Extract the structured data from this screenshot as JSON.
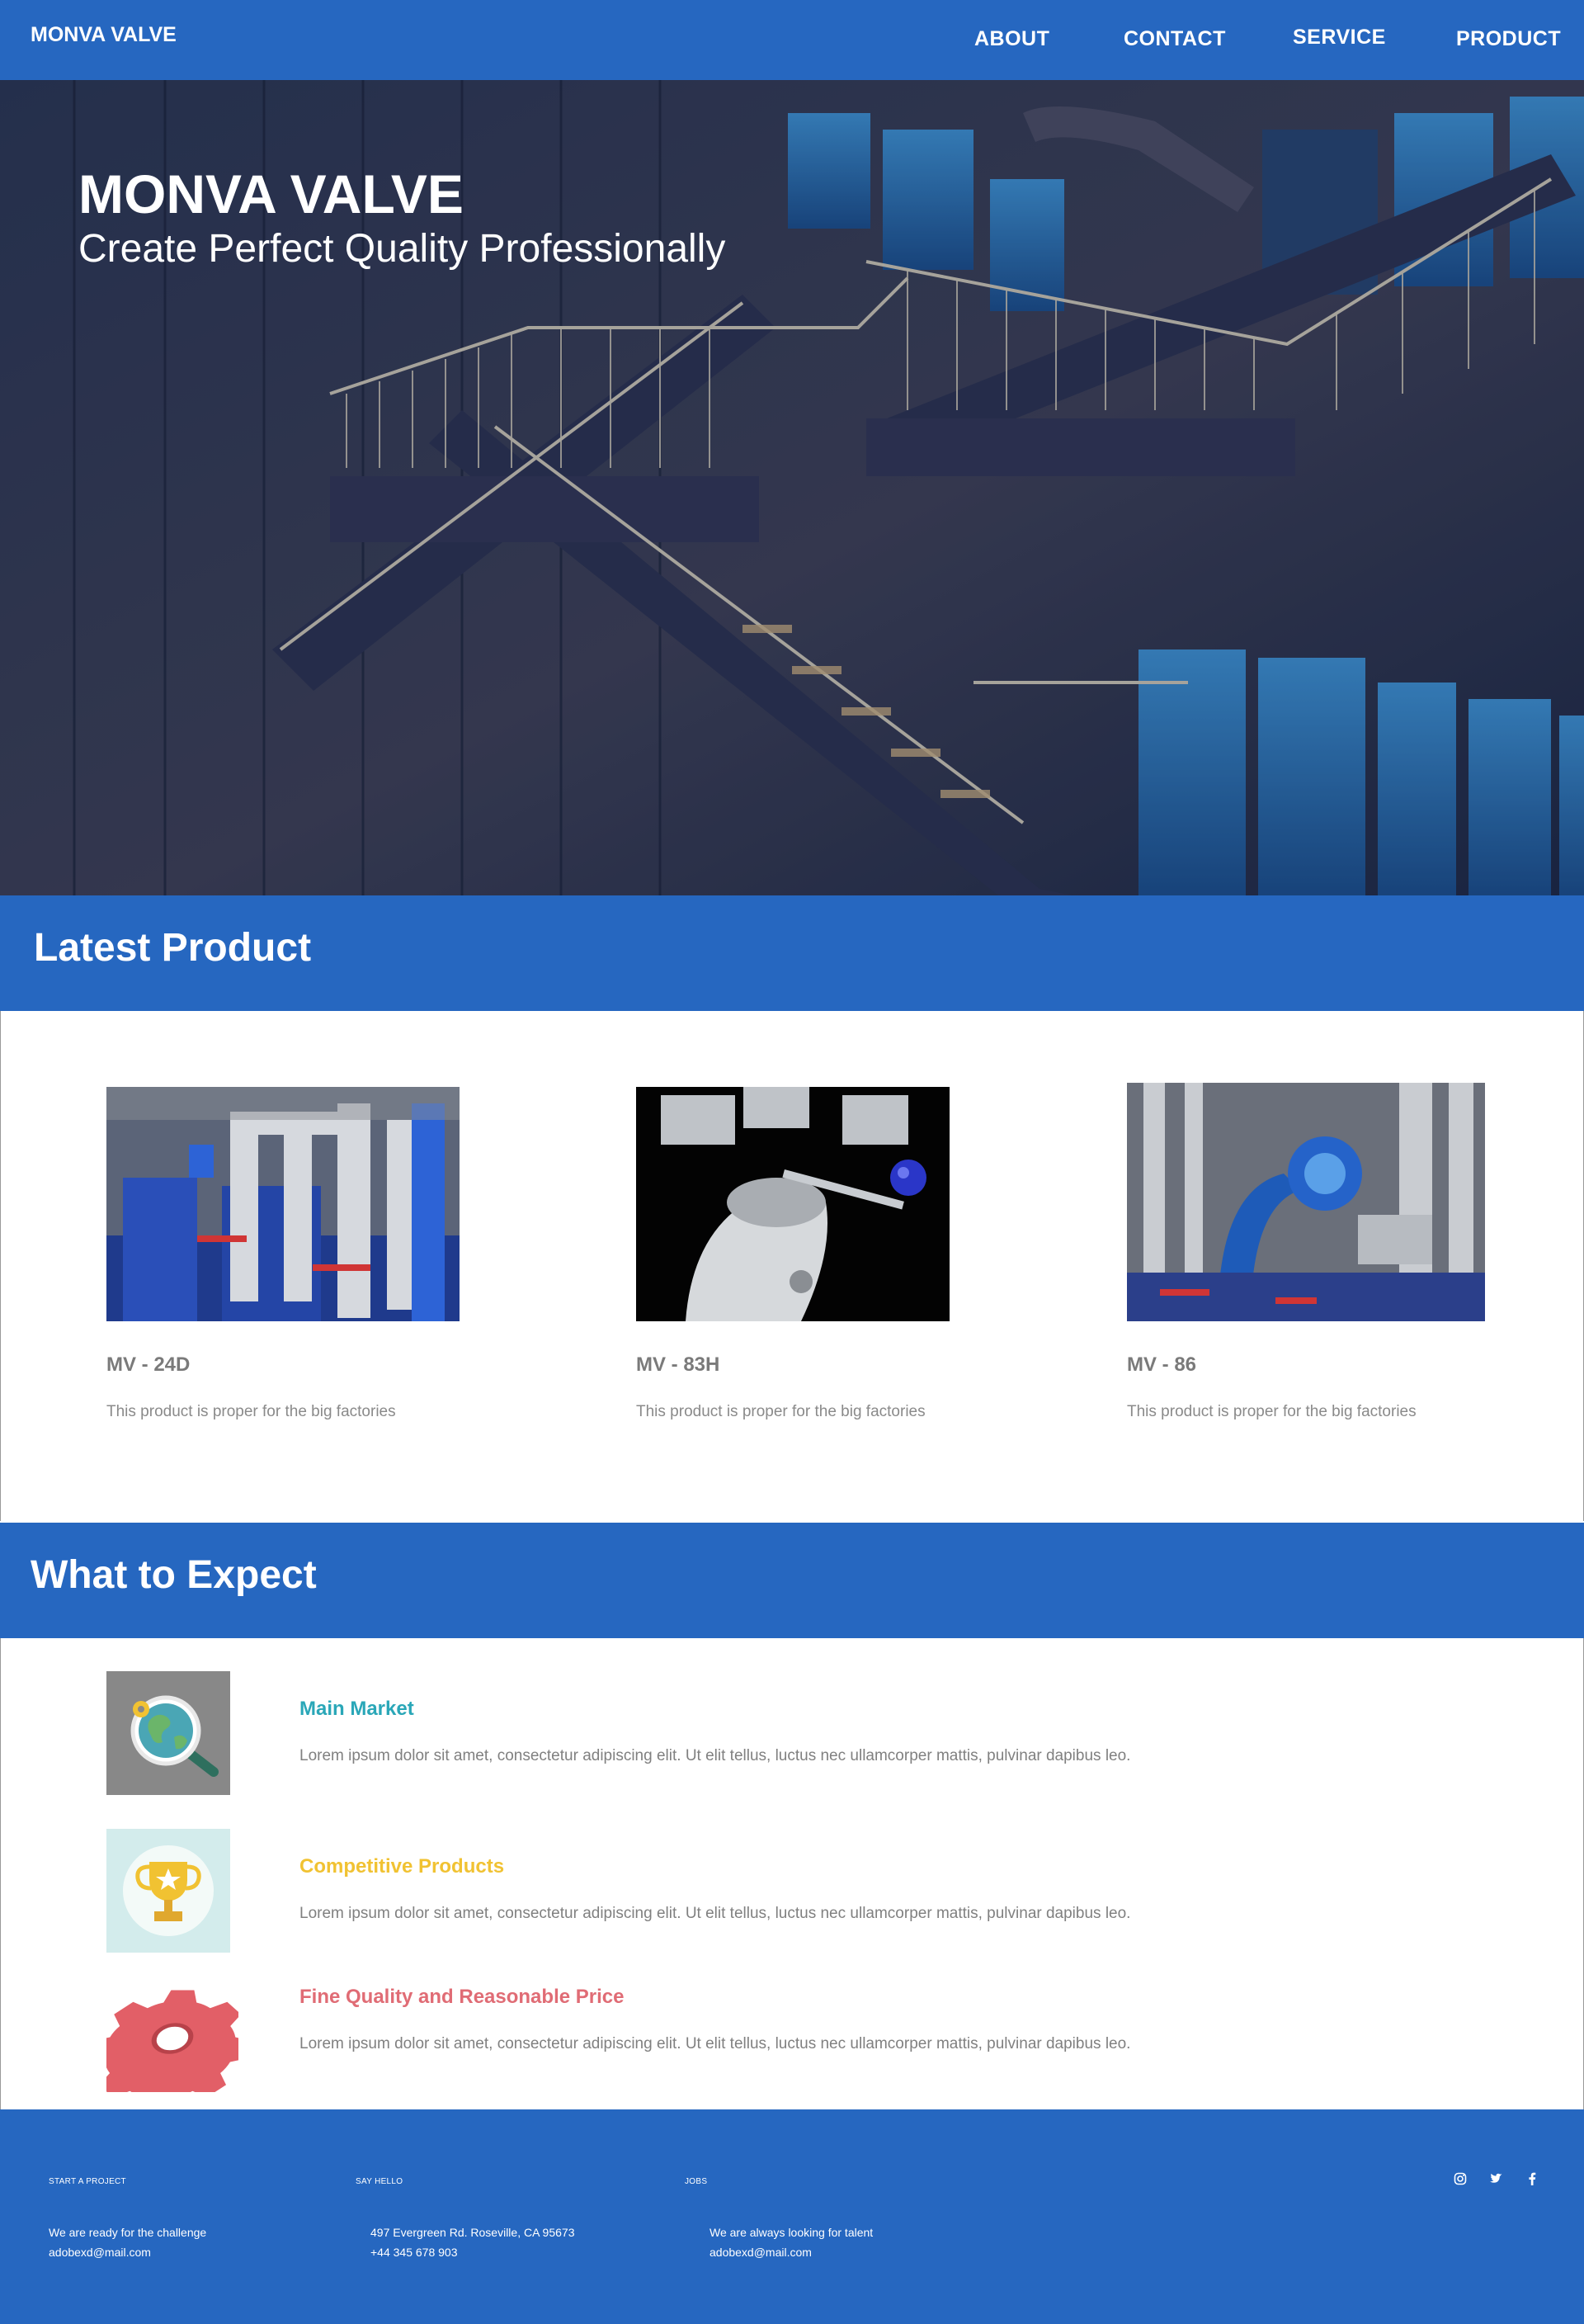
{
  "nav": {
    "brand": "MONVA VALVE",
    "links": [
      "ABOUT",
      "CONTACT",
      "SERVICE",
      "PRODUCT"
    ]
  },
  "hero": {
    "title": "MONVA VALVE",
    "subtitle": "Create Perfect Quality Professionally"
  },
  "latest": {
    "heading": "Latest Product",
    "items": [
      {
        "name": "MV - 24D",
        "desc": "This product is proper for the big factories",
        "image": "industrial-pipes-image"
      },
      {
        "name": "MV - 83H",
        "desc": "This product is proper for the big factories",
        "image": "butterfly-valve-image"
      },
      {
        "name": "MV - 86",
        "desc": "This product is proper for the big factories",
        "image": "blue-valves-image"
      }
    ]
  },
  "expect": {
    "heading": "What to Expect",
    "items": [
      {
        "title": "Main Market",
        "text": "Lorem ipsum dolor sit amet, consectetur adipiscing elit. Ut elit tellus, luctus nec ullamcorper mattis, pulvinar dapibus leo.",
        "color": "#2aa7b8",
        "icon": "globe-magnifier-icon"
      },
      {
        "title": "Competitive Products",
        "text": "Lorem ipsum dolor sit amet, consectetur adipiscing elit. Ut elit tellus, luctus nec ullamcorper mattis, pulvinar dapibus leo.",
        "color": "#f1c232",
        "icon": "trophy-icon"
      },
      {
        "title": "Fine Quality and Reasonable Price",
        "text": "Lorem ipsum dolor sit amet, consectetur adipiscing elit. Ut elit tellus, luctus nec ullamcorper mattis, pulvinar dapibus leo.",
        "color": "#e06c75",
        "icon": "gear-icon"
      }
    ]
  },
  "footer": {
    "columns": [
      {
        "heading": "START A PROJECT",
        "lines": [
          "We are ready for the challenge",
          "adobexd@mail.com"
        ]
      },
      {
        "heading": "SAY HELLO",
        "lines": [
          "497 Evergreen Rd. Roseville, CA 95673",
          "+44 345 678 903"
        ]
      },
      {
        "heading": "JOBS",
        "lines": [
          "We are always looking for talent",
          "adobexd@mail.com"
        ]
      }
    ],
    "social": [
      "instagram-icon",
      "twitter-icon",
      "facebook-icon"
    ]
  },
  "colors": {
    "primary": "#2667c0",
    "text_gray": "#808080"
  }
}
